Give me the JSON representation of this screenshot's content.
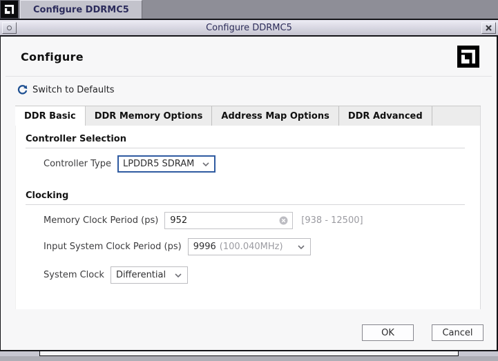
{
  "window": {
    "taskbar_tab_label": "Configure DDRMC5",
    "title": "Configure DDRMC5"
  },
  "header": {
    "title": "Configure",
    "switch_to_defaults_label": "Switch to Defaults"
  },
  "tabs": [
    {
      "label": "DDR Basic",
      "active": true
    },
    {
      "label": "DDR Memory Options",
      "active": false
    },
    {
      "label": "Address Map Options",
      "active": false
    },
    {
      "label": "DDR Advanced",
      "active": false
    }
  ],
  "controller_selection": {
    "title": "Controller Selection",
    "controller_type": {
      "label": "Controller Type",
      "value": "LPDDR5 SDRAM"
    }
  },
  "clocking": {
    "title": "Clocking",
    "memory_clock_period": {
      "label": "Memory Clock Period (ps)",
      "value": "952",
      "range": "[938 - 12500]"
    },
    "input_system_clock_period": {
      "label": "Input System Clock Period (ps)",
      "value": "9996",
      "frequency": "(100.040MHz)"
    },
    "system_clock": {
      "label": "System Clock",
      "value": "Differential"
    }
  },
  "footer": {
    "ok_label": "OK",
    "cancel_label": "Cancel"
  },
  "icons": {
    "logo": "amd-logo",
    "refresh": "refresh-circular-arrow",
    "clear_field": "clear-circle-x",
    "dropdown": "chevron-down",
    "window_close": "close-x",
    "window_menu": "menu-dot"
  },
  "colors": {
    "focus_border": "#2e5aa0",
    "refresh_icon_blue": "#1d4f91",
    "hint_text": "#9b9ba1",
    "titlebar_text": "#2d2d5a",
    "tab_active_bg": "#ffffff",
    "tab_strip_bg": "#ececec"
  }
}
